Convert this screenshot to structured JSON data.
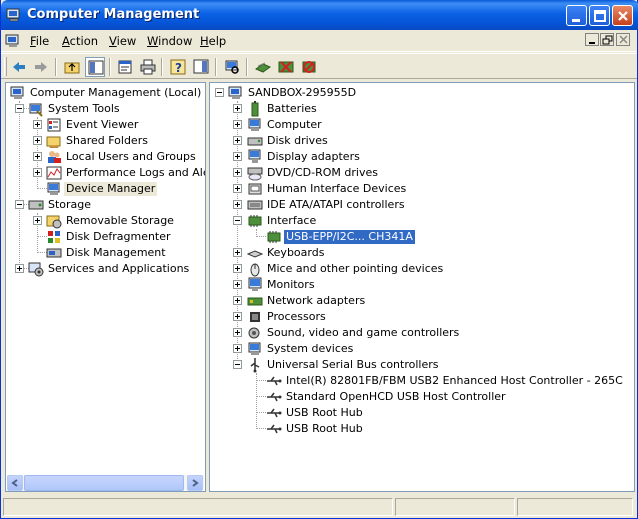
{
  "window": {
    "title": "Computer Management"
  },
  "menubar": {
    "items": [
      {
        "label": "File",
        "accel": "F",
        "rest": "ile"
      },
      {
        "label": "Action",
        "accel": "A",
        "rest": "ction"
      },
      {
        "label": "View",
        "accel": "V",
        "rest": "iew"
      },
      {
        "label": "Window",
        "accel": "W",
        "rest": "indow"
      },
      {
        "label": "Help",
        "accel": "H",
        "rest": "elp"
      }
    ]
  },
  "toolbar": {
    "buttons": [
      "back-icon",
      "forward-icon",
      "up-folder-icon",
      "show-hide-tree-icon",
      "properties-icon",
      "print-icon",
      "help-icon",
      "show-hide-action-pane-icon",
      "scan-hardware-icon",
      "update-driver-icon",
      "disable-device-icon",
      "uninstall-device-icon"
    ]
  },
  "tree": {
    "root": "Computer Management (Local)",
    "system_tools": "System Tools",
    "event_viewer": "Event Viewer",
    "shared_folders": "Shared Folders",
    "local_users": "Local Users and Groups",
    "perf_logs": "Performance Logs and Alerts",
    "device_manager": "Device Manager",
    "storage": "Storage",
    "removable_storage": "Removable Storage",
    "disk_defrag": "Disk Defragmenter",
    "disk_management": "Disk Management",
    "services": "Services and Applications"
  },
  "devices": {
    "computer_name": "SANDBOX-295955D",
    "categories": {
      "batteries": "Batteries",
      "computer": "Computer",
      "disk_drives": "Disk drives",
      "display_adapters": "Display adapters",
      "dvd": "DVD/CD-ROM drives",
      "hid": "Human Interface Devices",
      "ide": "IDE ATA/ATAPI controllers",
      "interface": "Interface",
      "interface_child": "USB-EPP/I2C... CH341A",
      "keyboards": "Keyboards",
      "mice": "Mice and other pointing devices",
      "monitors": "Monitors",
      "network": "Network adapters",
      "processors": "Processors",
      "sound": "Sound, video and game controllers",
      "system": "System devices",
      "usb": "Universal Serial Bus controllers",
      "usb_child_1": "Intel(R) 82801FB/FBM USB2 Enhanced Host Controller - 265C",
      "usb_child_2": "Standard OpenHCD USB Host Controller",
      "usb_child_3": "USB Root Hub",
      "usb_child_4": "USB Root Hub"
    }
  },
  "colors": {
    "titlebar": "#0553d6",
    "selection": "#316ac5",
    "window_bg": "#ece9d8"
  }
}
